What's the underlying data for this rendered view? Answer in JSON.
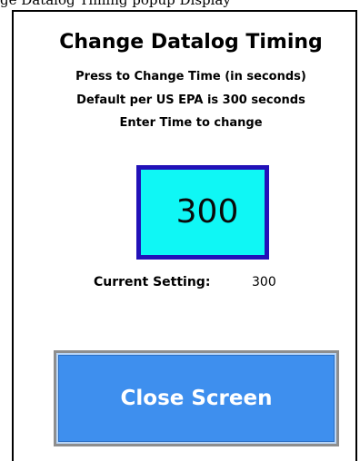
{
  "caption": "ge Datalog Timing popup Display",
  "screen": {
    "title": "Change Datalog Timing",
    "instructions": [
      "Press to Change Time (in seconds)",
      "Default per US EPA is 300 seconds",
      "Enter Time to change"
    ],
    "time_input": {
      "value": "300"
    },
    "current_setting": {
      "label": "Current Setting:",
      "value": "300"
    },
    "close_button": {
      "label": "Close Screen"
    }
  },
  "colors": {
    "input_fill": "#0ff7f5",
    "input_border": "#2211b8",
    "button_fill": "#3e8fee",
    "button_text": "#ffffff"
  }
}
